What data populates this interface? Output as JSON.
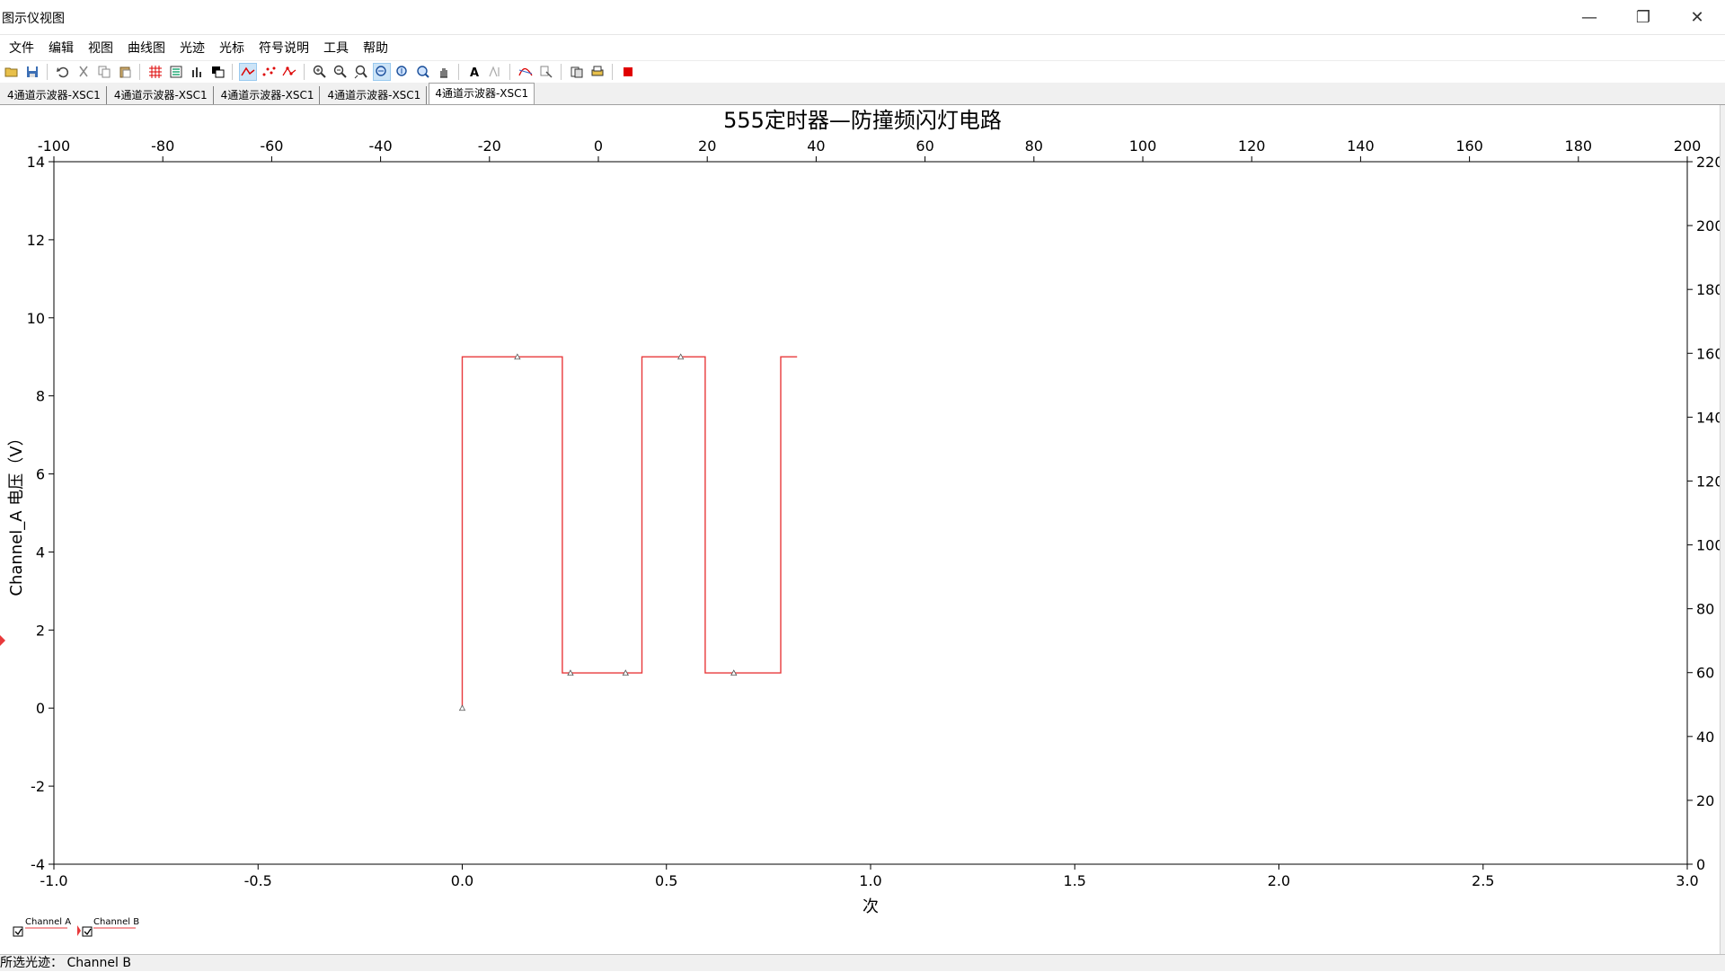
{
  "window": {
    "title": "图示仪视图",
    "minimize_glyph": "—",
    "restore_glyph": "❐",
    "close_glyph": "✕"
  },
  "menu": [
    "文件",
    "编辑",
    "视图",
    "曲线图",
    "光迹",
    "光标",
    "符号说明",
    "工具",
    "帮助"
  ],
  "toolbar_icons": [
    "open-icon",
    "save-icon",
    "sep",
    "undo-icon",
    "cut-icon",
    "copy-icon",
    "paste-icon",
    "sep",
    "grid-icon",
    "legend-icon",
    "bar-icon",
    "overlay-icon",
    "sep",
    "line-trace-icon",
    "dots-trace-icon",
    "marker-trace-icon",
    "sep",
    "zoom-in-icon",
    "zoom-out-icon",
    "zoom-fit-icon",
    "zoom-x-icon",
    "zoom-y-icon",
    "zoom-all-icon",
    "pan-hand-icon",
    "sep",
    "text-icon",
    "cursor-text-icon",
    "sep",
    "curve-fit-icon",
    "properties-icon",
    "sep",
    "export-icon",
    "print-icon",
    "sep",
    "stop-icon"
  ],
  "tabs": [
    {
      "label": "4通道示波器-XSC1",
      "active": false
    },
    {
      "label": "4通道示波器-XSC1",
      "active": false
    },
    {
      "label": "4通道示波器-XSC1",
      "active": false
    },
    {
      "label": "4通道示波器-XSC1",
      "active": false
    },
    {
      "label": "4通道示波器-XSC1",
      "active": true
    }
  ],
  "legend": [
    {
      "label": "Channel A",
      "checked": true
    },
    {
      "label": "Channel B",
      "checked": true
    }
  ],
  "status": {
    "text": "所选光迹：  Channel B"
  },
  "chart_data": {
    "type": "line",
    "title": "555定时器—防撞频闪灯电路",
    "xlabel": "次",
    "ylabel": "Channel_A 电压（V）",
    "xlim": [
      -1.0,
      3.0
    ],
    "ylim": [
      -4,
      14
    ],
    "x_ticks": [
      -1.0,
      -0.5,
      0.0,
      0.5,
      1.0,
      1.5,
      2.0,
      2.5,
      3.0
    ],
    "x_tick_labels": [
      "-1.0",
      "-0.5",
      "0.0",
      "0.5",
      "1.0",
      "1.5",
      "2.0",
      "2.5",
      "3.0"
    ],
    "y_ticks": [
      -4,
      -2,
      0,
      2,
      4,
      6,
      8,
      10,
      12,
      14
    ],
    "top_axis": {
      "lim": [
        -100,
        200
      ],
      "ticks": [
        -100,
        -80,
        -60,
        -40,
        -20,
        0,
        20,
        40,
        60,
        80,
        100,
        120,
        140,
        160,
        180,
        200
      ]
    },
    "right_axis": {
      "lim": [
        0,
        220
      ],
      "ticks": [
        0,
        20,
        40,
        60,
        80,
        100,
        120,
        140,
        160,
        180,
        200,
        220
      ]
    },
    "grid": false,
    "color": "#e8393b",
    "series": [
      {
        "name": "Channel A",
        "x": [
          0.0,
          0.0,
          0.245,
          0.245,
          0.44,
          0.44,
          0.595,
          0.595,
          0.78,
          0.78,
          0.82
        ],
        "y": [
          0.0,
          9.0,
          9.0,
          0.9,
          0.9,
          9.0,
          9.0,
          0.9,
          0.9,
          9.0,
          9.0
        ]
      }
    ],
    "markers": [
      {
        "x": 0.0,
        "y": 0.0
      },
      {
        "x": 0.135,
        "y": 9.0
      },
      {
        "x": 0.265,
        "y": 0.9
      },
      {
        "x": 0.4,
        "y": 0.9
      },
      {
        "x": 0.535,
        "y": 9.0
      },
      {
        "x": 0.665,
        "y": 0.9
      }
    ]
  }
}
